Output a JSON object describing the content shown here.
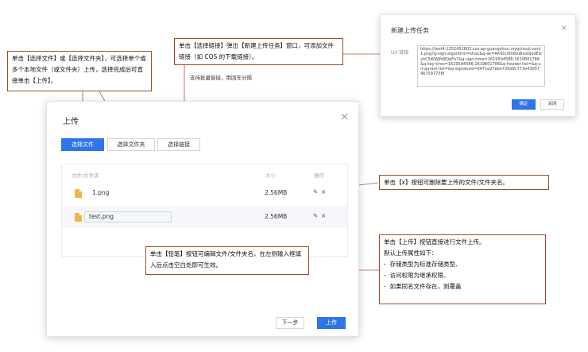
{
  "upload_dialog": {
    "title": "上传",
    "close": "×",
    "tabs": [
      "选择文件",
      "选择文件夹",
      "选择链接"
    ],
    "table": {
      "headers": [
        "文件/文件夹",
        "大小",
        "操作"
      ],
      "rows": [
        {
          "name": "1.png",
          "size": "2.56MB",
          "editing": false
        },
        {
          "name": "test.png",
          "size": "2.56MB",
          "editing": true
        }
      ],
      "edit_icon": "pencil-icon",
      "delete_icon": "close-icon"
    },
    "footer": {
      "prev": "下一步",
      "upload": "上传"
    }
  },
  "link_dialog": {
    "title": "新建上传任务",
    "close": "×",
    "url_label": "Url 链接",
    "url_value": "https://test4-1252452803.cos.ap-guangzhou.myqcloud.com/1.png?q-sign-algorithm=sha1&q-ak=AKIDcXDdVuBzoOjodEizyhC5WWJfd8QeFo7&q-sign-time=1619594586;1619601786&q-key-time=1619594586;1619601786&q-header-list=&q-url-param-list=&q-signature=d471e27ebe726d9c773e43d574b7097736f",
    "ok": "确定",
    "cancel": "关闭"
  },
  "annotations": {
    "select_file": "单击【选择文件】或【选择文件夹】，可选择单个或多个本地文件（或文件夹）上传，选择完成后可直接单击【上传】。",
    "select_link": "单击【选择链接】弹出【新建上传任务】窗口，可添加文件链接（如 COS 的下载链接）。",
    "batch_link": "支持批量链接，用回车分隔",
    "delete": "单击【x】按钮可删除要上传的文件/文件夹名。",
    "pencil": "单击【铅笔】按钮可编辑文件/文件夹名，在左侧输入框填入后点击空白处即可生效。",
    "upload_title": "单击【上传】按钮直接进行文件上传。",
    "upload_default": "默认上传属性如下：",
    "upload_items": [
      "存储类型为标准存储类型、",
      "访问权限为继承权限、",
      "如果同名文件存在，则覆盖"
    ]
  },
  "colors": {
    "primary": "#2f74e9",
    "annotation_border": "#a04b23"
  }
}
